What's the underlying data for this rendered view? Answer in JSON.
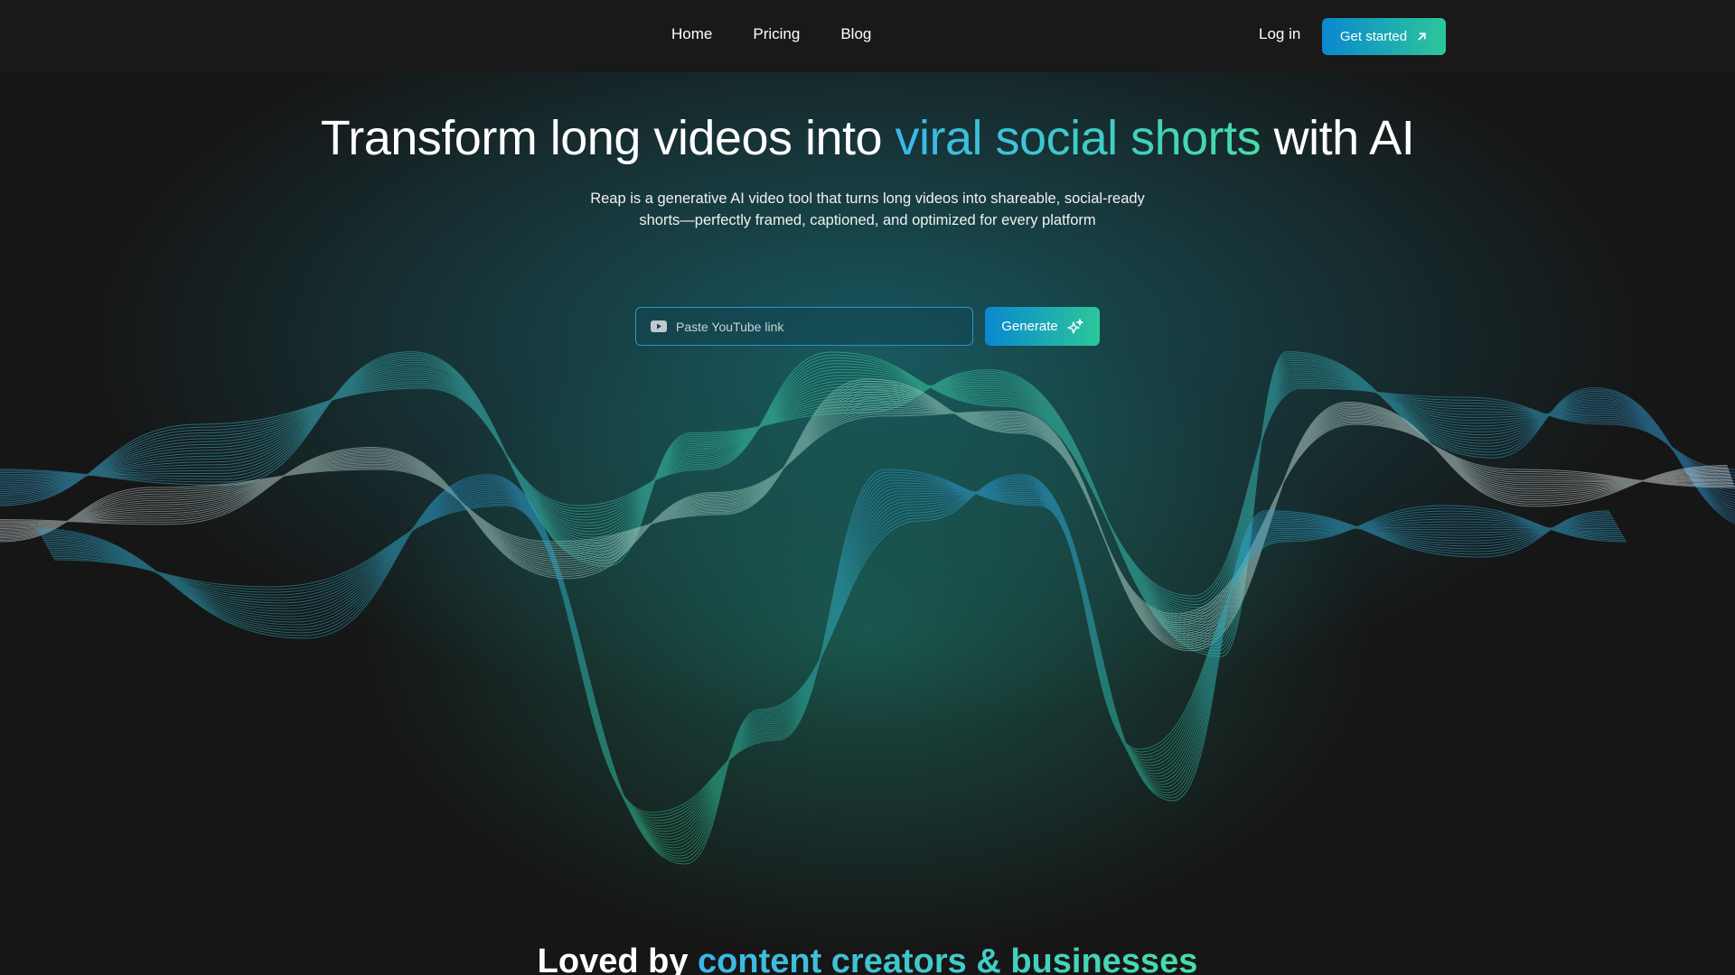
{
  "colors": {
    "grad_start": "#0a88d0",
    "grad_end": "#2cc79a",
    "background": "#161616",
    "accent_blue": "#39b8e8",
    "accent_green": "#47dcaa"
  },
  "nav": {
    "links": [
      {
        "label": "Home"
      },
      {
        "label": "Pricing"
      },
      {
        "label": "Blog"
      }
    ],
    "login_label": "Log in",
    "cta_label": "Get started",
    "cta_icon": "arrow-up-right-icon"
  },
  "hero": {
    "headline_part1": "Transform long videos into ",
    "headline_highlight": "viral social shorts",
    "headline_part2": " with AI",
    "subtitle": "Reap is a generative AI video tool that turns long videos into shareable, social-ready shorts—perfectly framed, captioned, and optimized for every platform",
    "input_placeholder": "Paste YouTube link",
    "input_icon": "youtube-icon",
    "generate_label": "Generate",
    "generate_icon": "sparkles-icon"
  },
  "section": {
    "loved_prefix": "Loved by ",
    "loved_highlight": "content creators & businesses"
  }
}
